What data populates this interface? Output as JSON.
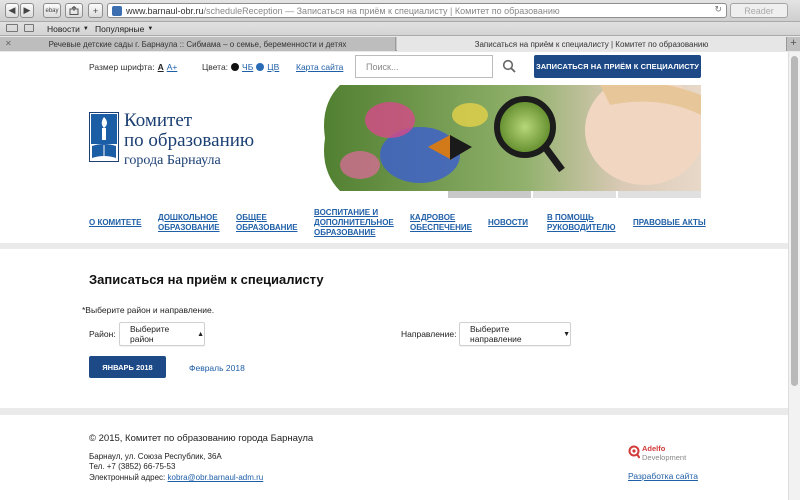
{
  "browser": {
    "url_main": "www.barnaul-obr.ru",
    "url_path": "/scheduleReception",
    "page_title": "Записаться на приём к специалисту | Комитет по образованию",
    "reader_label": "Reader",
    "bookmarks": [
      {
        "label": "Новости"
      },
      {
        "label": "Популярные"
      }
    ],
    "tabs": [
      {
        "label": "Речевые детские сады г. Барнаула :: Сибмама – о семье, беременности и детях",
        "active": false
      },
      {
        "label": "Записаться на приём к специалисту | Комитет по образованию",
        "active": true
      }
    ],
    "new_tab_label": "+",
    "ebay_label": "ebay"
  },
  "util": {
    "font_size_label": "Размер шрифта:",
    "font_a": "A",
    "font_a_plus": "A+",
    "colors_label": "Цвета:",
    "color_bw": "ЧБ",
    "color_cv": "ЦВ",
    "site_map": "Карта сайта",
    "search_placeholder": "Поиск...",
    "cta": "ЗАПИСАТЬСЯ НА ПРИЁМ К СПЕЦИАЛИСТУ"
  },
  "org": {
    "line1": "Комитет",
    "line2": "по образованию",
    "line3": "города Барнаула"
  },
  "nav": [
    {
      "l1": "О КОМИТЕТЕ",
      "l2": "",
      "l3": ""
    },
    {
      "l1": "ДОШКОЛЬНОЕ",
      "l2": "ОБРАЗОВАНИЕ",
      "l3": ""
    },
    {
      "l1": "ОБЩЕЕ",
      "l2": "ОБРАЗОВАНИЕ",
      "l3": ""
    },
    {
      "l1": "ВОСПИТАНИЕ И",
      "l2": "ДОПОЛНИТЕЛЬНОЕ",
      "l3": "ОБРАЗОВАНИЕ"
    },
    {
      "l1": "КАДРОВОЕ",
      "l2": "ОБЕСПЕЧЕНИЕ",
      "l3": ""
    },
    {
      "l1": "НОВОСТИ",
      "l2": "",
      "l3": ""
    },
    {
      "l1": "В ПОМОЩЬ",
      "l2": "РУКОВОДИТЕЛЮ",
      "l3": ""
    },
    {
      "l1": "ПРАВОВЫЕ АКТЫ",
      "l2": "",
      "l3": ""
    }
  ],
  "main": {
    "title": "Записаться на приём к специалисту",
    "hint": "*Выберите район и направление.",
    "district_label": "Район:",
    "district_value": "Выберите район",
    "direction_label": "Направление:",
    "direction_value": "Выберите направление",
    "month_active": "ЯНВАРЬ 2018",
    "month_next": "Февраль 2018"
  },
  "footer": {
    "copyright": "© 2015, Комитет по образованию города Барнаула",
    "address": "Барнаул, ул. Союза Республик, 36А",
    "phone": "Тел. +7 (3852) 66-75-53",
    "email_label": "Электронный адрес:",
    "email": "kobra@obr.barnaul-adm.ru",
    "dev_name": "Adelfo",
    "dev_sub": "Development",
    "dev_link": "Разработка сайта"
  },
  "colors": {
    "brand": "#1d4a87",
    "link": "#1f5fa7"
  }
}
